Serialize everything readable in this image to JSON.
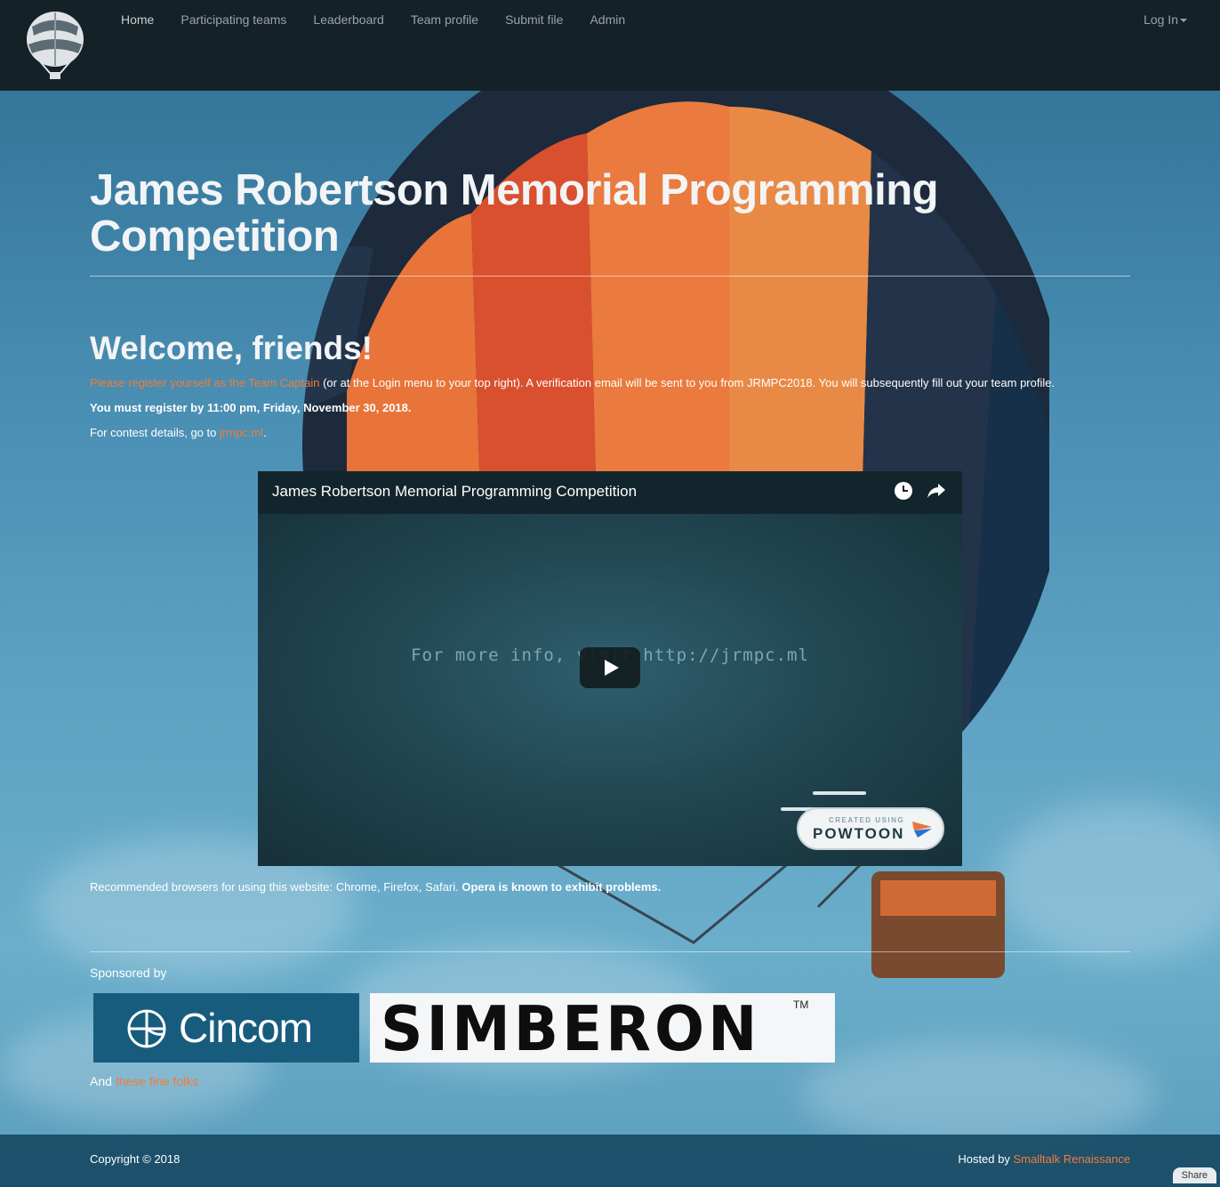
{
  "nav": {
    "brand_icon": "hot-air-balloon-logo",
    "links": [
      "Home",
      "Participating teams",
      "Leaderboard",
      "Team profile",
      "Submit file",
      "Admin"
    ],
    "login": "Log In"
  },
  "hero": {
    "title": "James Robertson Memorial Programming Competition"
  },
  "welcome": {
    "heading": "Welcome, friends!",
    "register_link": "Please register yourself as the Team Captain",
    "register_rest": " (or at the Login menu to your top right). A verification email will be sent to you from JRMPC2018. You will subsequently fill out your team profile.",
    "deadline": "You must register by 11:00 pm, Friday, November 30, 2018.",
    "details_prefix": "For contest details, go to ",
    "details_link": "jrmpc.ml",
    "details_suffix": "."
  },
  "video": {
    "title": "James Robertson Memorial Programming Competition",
    "caption": "For more info, visit http://jrmpc.ml",
    "icons": [
      "clock-icon",
      "share-icon",
      "play-icon"
    ],
    "badge_small": "CREATED USING",
    "badge_name": "POWTOON"
  },
  "browsers": {
    "normal": "Recommended browsers for using this website: Chrome, Firefox, Safari. ",
    "bold": "Opera is known to exhibit problems."
  },
  "sponsors": {
    "label": "Sponsored by",
    "cincom": "Cincom",
    "simberon": "SIMBERON",
    "simberon_tm": "TM",
    "and_prefix": "And ",
    "and_link": "these fine folks"
  },
  "footer": {
    "copyright": "Copyright © 2018",
    "hosted_prefix": "Hosted by ",
    "hosted_link": "Smalltalk Renaissance",
    "share": "Share"
  },
  "colors": {
    "navbar": "#142126",
    "link_orange": "#f07c3a",
    "cincom_blue": "#185c7d"
  }
}
